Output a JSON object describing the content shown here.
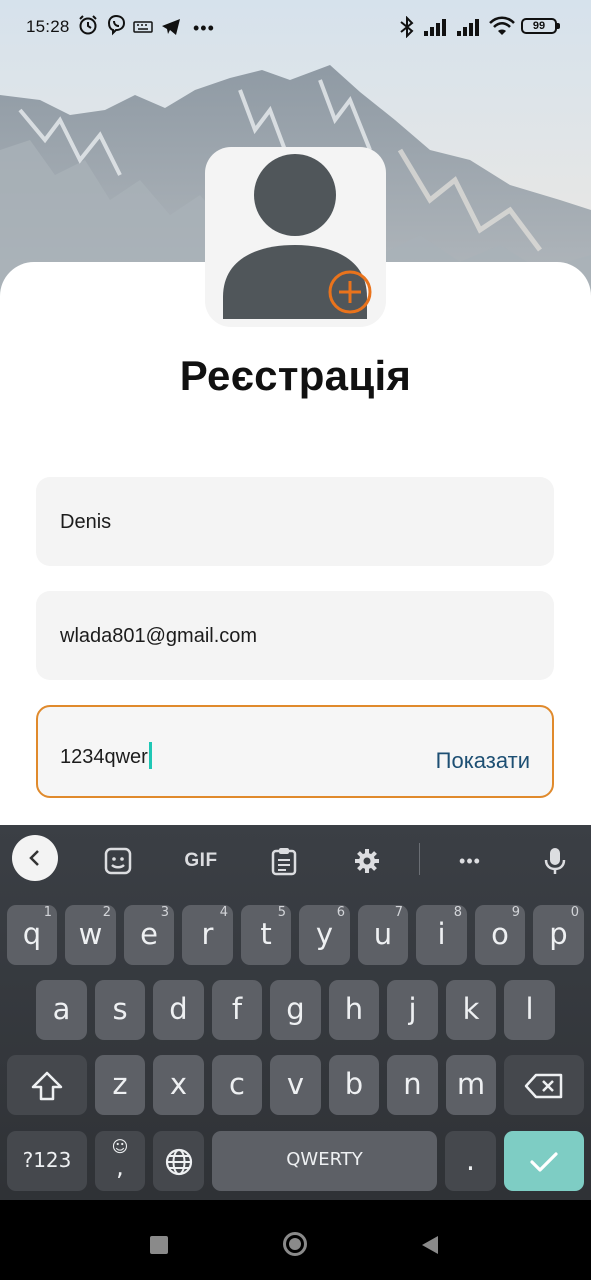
{
  "status_bar": {
    "time": "15:28",
    "battery": "99",
    "icons": [
      "alarm-icon",
      "viber-icon",
      "keyboard-icon",
      "telegram-icon",
      "more-icon",
      "bluetooth-icon",
      "signal-icon",
      "signal-icon",
      "wifi-icon",
      "battery-icon"
    ]
  },
  "avatar": {
    "add_icon": "plus-circle-icon",
    "accent": "#e9731c"
  },
  "page": {
    "title": "Реєстрація"
  },
  "form": {
    "name_value": "Denis",
    "email_value": "wlada801@gmail.com",
    "password_value": "1234qwer",
    "show_label": "Показати",
    "active_border": "#e08a2c"
  },
  "keyboard": {
    "toolbar": [
      "back-icon",
      "sticker-icon",
      "GIF",
      "clipboard-icon",
      "gear-icon",
      "more-icon",
      "mic-icon"
    ],
    "row1": [
      {
        "k": "q",
        "h": "1"
      },
      {
        "k": "w",
        "h": "2"
      },
      {
        "k": "e",
        "h": "3"
      },
      {
        "k": "r",
        "h": "4"
      },
      {
        "k": "t",
        "h": "5"
      },
      {
        "k": "y",
        "h": "6"
      },
      {
        "k": "u",
        "h": "7"
      },
      {
        "k": "i",
        "h": "8"
      },
      {
        "k": "o",
        "h": "9"
      },
      {
        "k": "p",
        "h": "0"
      }
    ],
    "row2": [
      "a",
      "s",
      "d",
      "f",
      "g",
      "h",
      "j",
      "k",
      "l"
    ],
    "row3": [
      "z",
      "x",
      "c",
      "v",
      "b",
      "n",
      "m"
    ],
    "sym_label": "?123",
    "comma": ",",
    "space_label": "QWERTY",
    "period": ".",
    "enter_color": "#7ecdc4"
  }
}
